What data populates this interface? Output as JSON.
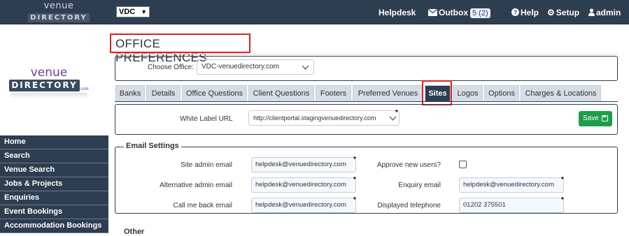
{
  "topbar": {
    "logo_line1": "venue",
    "logo_line2": "DIRECTORY",
    "office_code": "VDC",
    "helpdesk": "Helpdesk",
    "outbox_label": "Outbox",
    "outbox_count": "5 (2)",
    "help": "Help",
    "setup": "Setup",
    "user": "admin"
  },
  "sidebar": {
    "logo_line1": "venue",
    "logo_line2": "DIRECTORY",
    "logo_suffix": ".com",
    "items": [
      {
        "label": "Home"
      },
      {
        "label": "Search"
      },
      {
        "label": "Venue Search"
      },
      {
        "label": "Jobs & Projects"
      },
      {
        "label": "Enquiries"
      },
      {
        "label": "Event Bookings"
      },
      {
        "label": "Accommodation Bookings"
      }
    ]
  },
  "page": {
    "title": "OFFICE PREFERENCES",
    "choose_office_label": "Choose Office:",
    "choose_office_value": "VDC-venuedirectory.com"
  },
  "tabs": [
    {
      "label": "Banks",
      "active": false
    },
    {
      "label": "Details",
      "active": false
    },
    {
      "label": "Office Questions",
      "active": false
    },
    {
      "label": "Client Questions",
      "active": false
    },
    {
      "label": "Footers",
      "active": false
    },
    {
      "label": "Preferred Venues",
      "active": false
    },
    {
      "label": "Sites",
      "active": true
    },
    {
      "label": "Logos",
      "active": false
    },
    {
      "label": "Options",
      "active": false
    },
    {
      "label": "Charges & Locations",
      "active": false
    }
  ],
  "sites": {
    "white_label_url_label": "White Label URL",
    "white_label_url_value": "http://clientportal.stagingvenuedirectory.com",
    "save_label": "Save"
  },
  "email_settings": {
    "legend": "Email Settings",
    "site_admin_email_label": "Site admin email",
    "site_admin_email_value": "helpdesk@venuedirectory.com",
    "alt_admin_email_label": "Alternative admin email",
    "alt_admin_email_value": "helpdesk@venuedirectory.com",
    "call_me_back_label": "Call me back email",
    "call_me_back_value": "helpdesk@venuedirectory.com",
    "approve_new_users_label": "Approve new users?",
    "approve_new_users_checked": false,
    "enquiry_email_label": "Enquiry email",
    "enquiry_email_value": "helpdesk@venuedirectory.com",
    "displayed_telephone_label": "Displayed telephone",
    "displayed_telephone_value": "01202 375501"
  },
  "next_section_legend": "Other",
  "colors": {
    "navy": "#2d3e50",
    "highlight_red": "#e02020",
    "save_green": "#1e9e4a",
    "tab_bg": "#d5dde6"
  }
}
